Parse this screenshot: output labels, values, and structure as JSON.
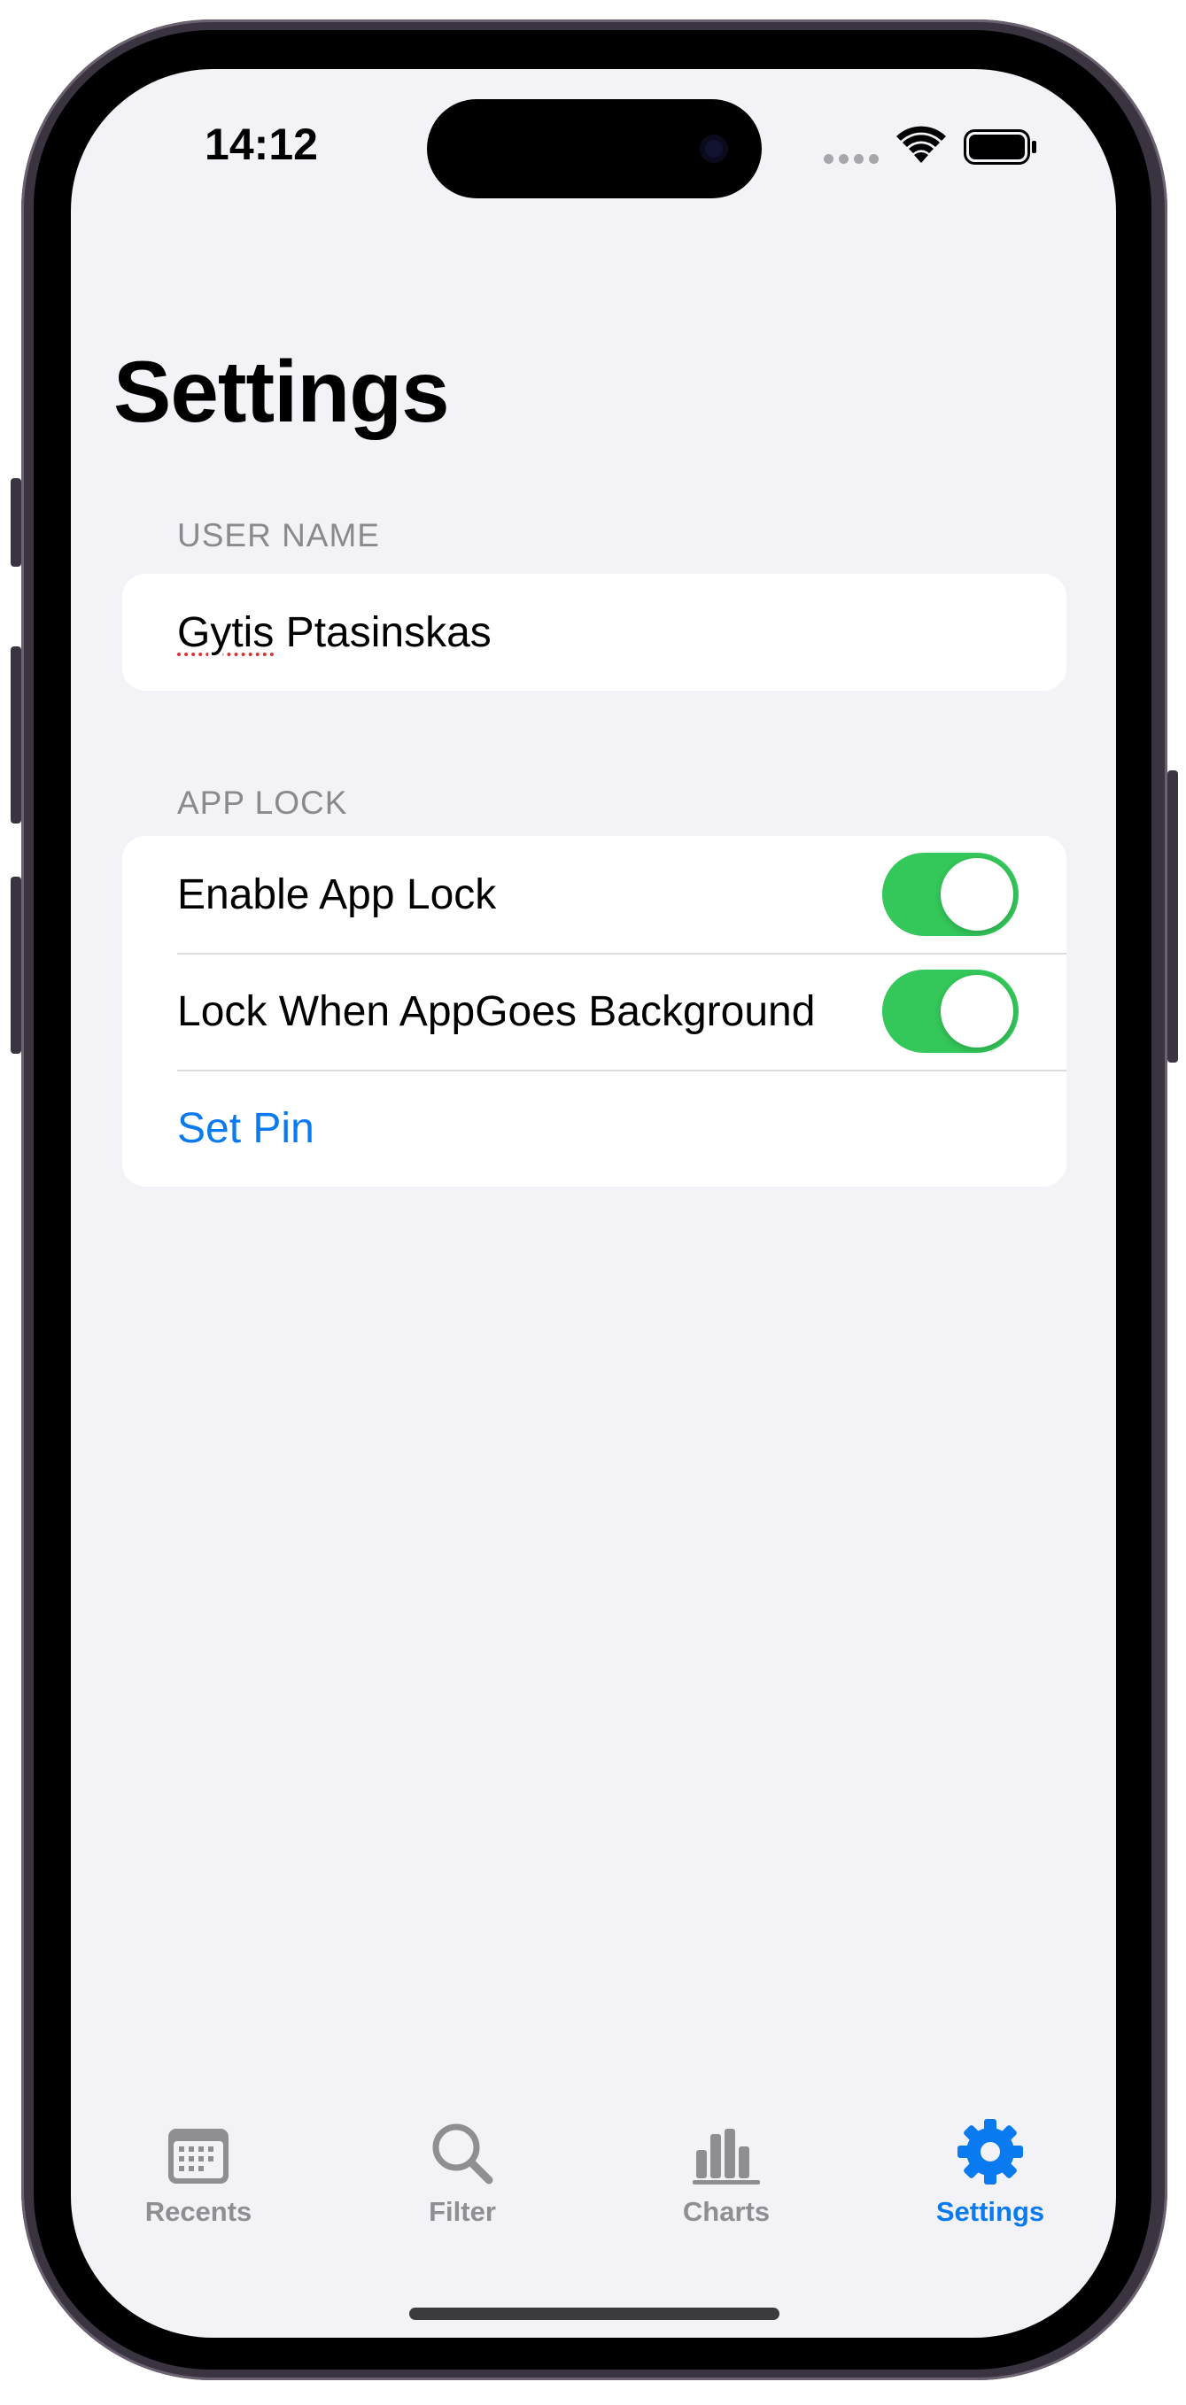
{
  "status_bar": {
    "time": "14:12"
  },
  "page": {
    "title": "Settings"
  },
  "sections": {
    "user_name": {
      "header": "USER NAME",
      "value_misspelled_part": "Gytis",
      "value_rest": " Ptasinskas"
    },
    "app_lock": {
      "header": "APP LOCK",
      "enable_label": "Enable App Lock",
      "enable_on": true,
      "background_label": "Lock When AppGoes Background",
      "background_on": true,
      "set_pin_label": "Set Pin"
    }
  },
  "tabs": [
    {
      "label": "Recents",
      "icon": "calendar-icon",
      "active": false
    },
    {
      "label": "Filter",
      "icon": "magnifier-icon",
      "active": false
    },
    {
      "label": "Charts",
      "icon": "bar-chart-icon",
      "active": false
    },
    {
      "label": "Settings",
      "icon": "gear-icon",
      "active": true
    }
  ],
  "colors": {
    "accent": "#0a7af0",
    "toggle_on": "#34c759",
    "background": "#f2f2f7",
    "inactive": "#8e8e93"
  }
}
